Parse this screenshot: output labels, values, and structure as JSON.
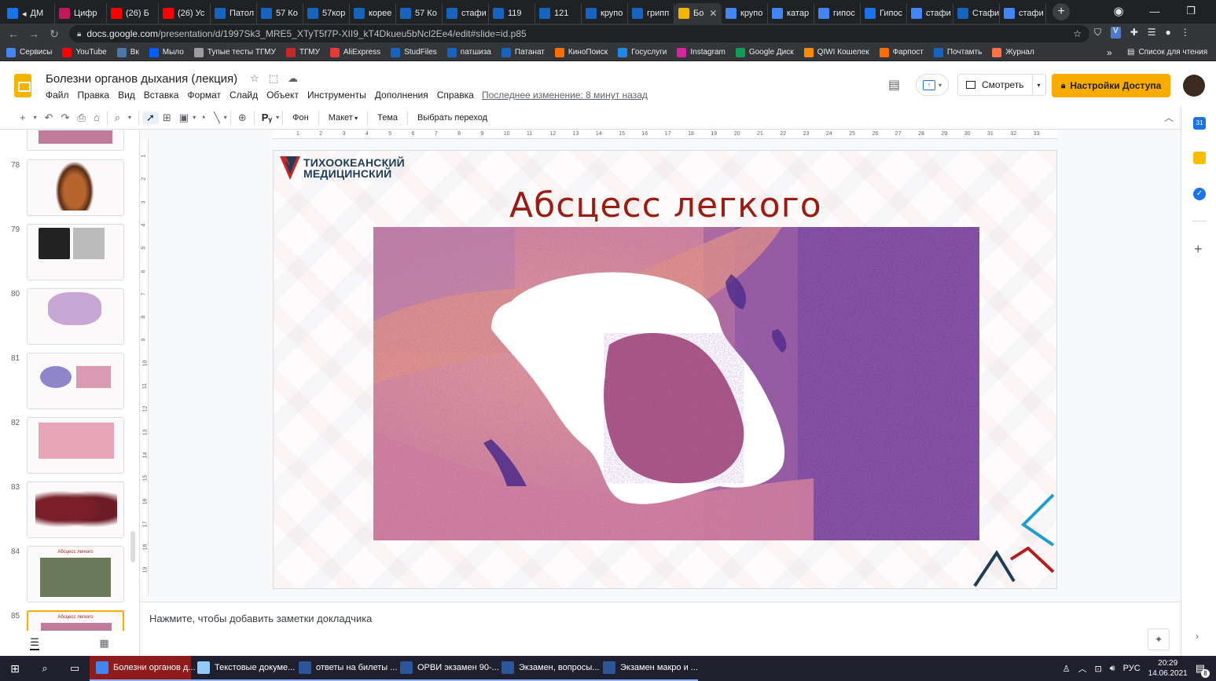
{
  "browser": {
    "tabs": [
      {
        "label": "ДМ",
        "color": "#1a73e8",
        "extra": "◂"
      },
      {
        "label": "Цифр",
        "color": "#c2185b"
      },
      {
        "label": "(26) Б",
        "color": "#ff0000"
      },
      {
        "label": "(26) Ус",
        "color": "#ff0000"
      },
      {
        "label": "Патол",
        "color": "#1565c0"
      },
      {
        "label": "57 Ко",
        "color": "#1565c0"
      },
      {
        "label": "57кор",
        "color": "#1565c0"
      },
      {
        "label": "корее",
        "color": "#1565c0"
      },
      {
        "label": "57 Ко",
        "color": "#1565c0"
      },
      {
        "label": "стафи",
        "color": "#1565c0"
      },
      {
        "label": "119",
        "color": "#1565c0"
      },
      {
        "label": "121",
        "color": "#1565c0"
      },
      {
        "label": "крупо",
        "color": "#1565c0"
      },
      {
        "label": "грипп",
        "color": "#1565c0"
      },
      {
        "label": "Бо",
        "color": "#f4b400",
        "active": true
      },
      {
        "label": "крупо",
        "color": "#4285f4"
      },
      {
        "label": "катар",
        "color": "#4285f4"
      },
      {
        "label": "гипос",
        "color": "#4285f4"
      },
      {
        "label": "Гипос",
        "color": "#1a73e8"
      },
      {
        "label": "стафи",
        "color": "#4285f4"
      },
      {
        "label": "Стафи",
        "color": "#1565c0"
      },
      {
        "label": "стафи",
        "color": "#4285f4"
      }
    ],
    "url_host": "docs.google.com",
    "url_path": "/presentation/d/1997Sk3_MRE5_XTyT5f7P-XII9_kT4Dkueu5bNcl2Ee4/edit#slide=id.p85",
    "bookmarks": [
      {
        "label": "Сервисы",
        "color": "#4285f4"
      },
      {
        "label": "YouTube",
        "color": "#ff0000"
      },
      {
        "label": "Вк",
        "color": "#4a76a8"
      },
      {
        "label": "Мыло",
        "color": "#005ff9"
      },
      {
        "label": "Тупые тесты ТГМУ",
        "color": "#9e9e9e"
      },
      {
        "label": "ТГМУ",
        "color": "#c62828"
      },
      {
        "label": "AliExpress",
        "color": "#e53935"
      },
      {
        "label": "StudFiles",
        "color": "#1565c0"
      },
      {
        "label": "патшиза",
        "color": "#1565c0"
      },
      {
        "label": "Патанат",
        "color": "#1565c0"
      },
      {
        "label": "КиноПоиск",
        "color": "#ff6d00"
      },
      {
        "label": "Госуслуги",
        "color": "#1e88e5"
      },
      {
        "label": "Instagram",
        "color": "#d6249f"
      },
      {
        "label": "Google Диск",
        "color": "#0f9d58"
      },
      {
        "label": "QIWI Кошелек",
        "color": "#ff8c00"
      },
      {
        "label": "Фарпост",
        "color": "#ff6f00"
      },
      {
        "label": "Почтамть",
        "color": "#1565c0"
      },
      {
        "label": "Журнал",
        "color": "#ff7043"
      }
    ],
    "bookmarks_more": "»",
    "reading_list": "Список для чтения"
  },
  "doc": {
    "title": "Болезни органов дыхания (лекция)",
    "menu": [
      "Файл",
      "Правка",
      "Вид",
      "Вставка",
      "Формат",
      "Слайд",
      "Объект",
      "Инструменты",
      "Дополнения",
      "Справка"
    ],
    "last_edit": "Последнее изменение: 8 минут назад",
    "present_label": "Смотреть",
    "share_label": "Настройки Доступа"
  },
  "toolbar": {
    "background": "Фон",
    "layout": "Макет",
    "theme": "Тема",
    "transition": "Выбрать переход"
  },
  "filmstrip": {
    "slides": [
      {
        "num": "78",
        "kind": "specimen"
      },
      {
        "num": "79",
        "kind": "xray"
      },
      {
        "num": "80",
        "kind": "micro-diagram"
      },
      {
        "num": "81",
        "kind": "two-images"
      },
      {
        "num": "82",
        "kind": "histology"
      },
      {
        "num": "83",
        "kind": "lungs"
      },
      {
        "num": "84",
        "kind": "titled",
        "title": "Абсцесс легкого"
      },
      {
        "num": "85",
        "kind": "titled",
        "title": "Абсцесс легкого",
        "active": true
      }
    ]
  },
  "slide": {
    "brand_line1": "ТИХООКЕАНСКИЙ",
    "brand_line2": "МЕДИЦИНСКИЙ",
    "title": "Абсцесс легкого",
    "title_color": "#9c1c12",
    "brand_color": "#1e3d59"
  },
  "ruler": {
    "h": [
      "1",
      "2",
      "3",
      "4",
      "5",
      "6",
      "7",
      "8",
      "9",
      "10",
      "11",
      "12",
      "13",
      "14",
      "15",
      "16",
      "17",
      "18",
      "19",
      "20",
      "21",
      "22",
      "23",
      "24",
      "25",
      "26",
      "27",
      "28",
      "29",
      "30",
      "31",
      "32",
      "33"
    ],
    "v": [
      "1",
      "2",
      "3",
      "4",
      "5",
      "6",
      "7",
      "8",
      "9",
      "10",
      "11",
      "12",
      "13",
      "14",
      "15",
      "16",
      "17",
      "18",
      "19"
    ]
  },
  "notes": {
    "placeholder": "Нажмите, чтобы добавить заметки докладчика"
  },
  "taskbar": {
    "apps": [
      {
        "label": "Болезни органов д...",
        "color": "#4285f4",
        "active": true
      },
      {
        "label": "Текстовые докуме...",
        "color": "#90caf9"
      },
      {
        "label": "ответы на билеты ...",
        "color": "#2b579a"
      },
      {
        "label": "ОРВИ экзамен 90-...",
        "color": "#2b579a"
      },
      {
        "label": "Экзамен, вопросы...",
        "color": "#2b579a"
      },
      {
        "label": "Экзамен макро и ...",
        "color": "#2b579a"
      }
    ],
    "lang": "РУС",
    "time": "20:29",
    "date": "14.06.2021",
    "notif_count": "8"
  }
}
